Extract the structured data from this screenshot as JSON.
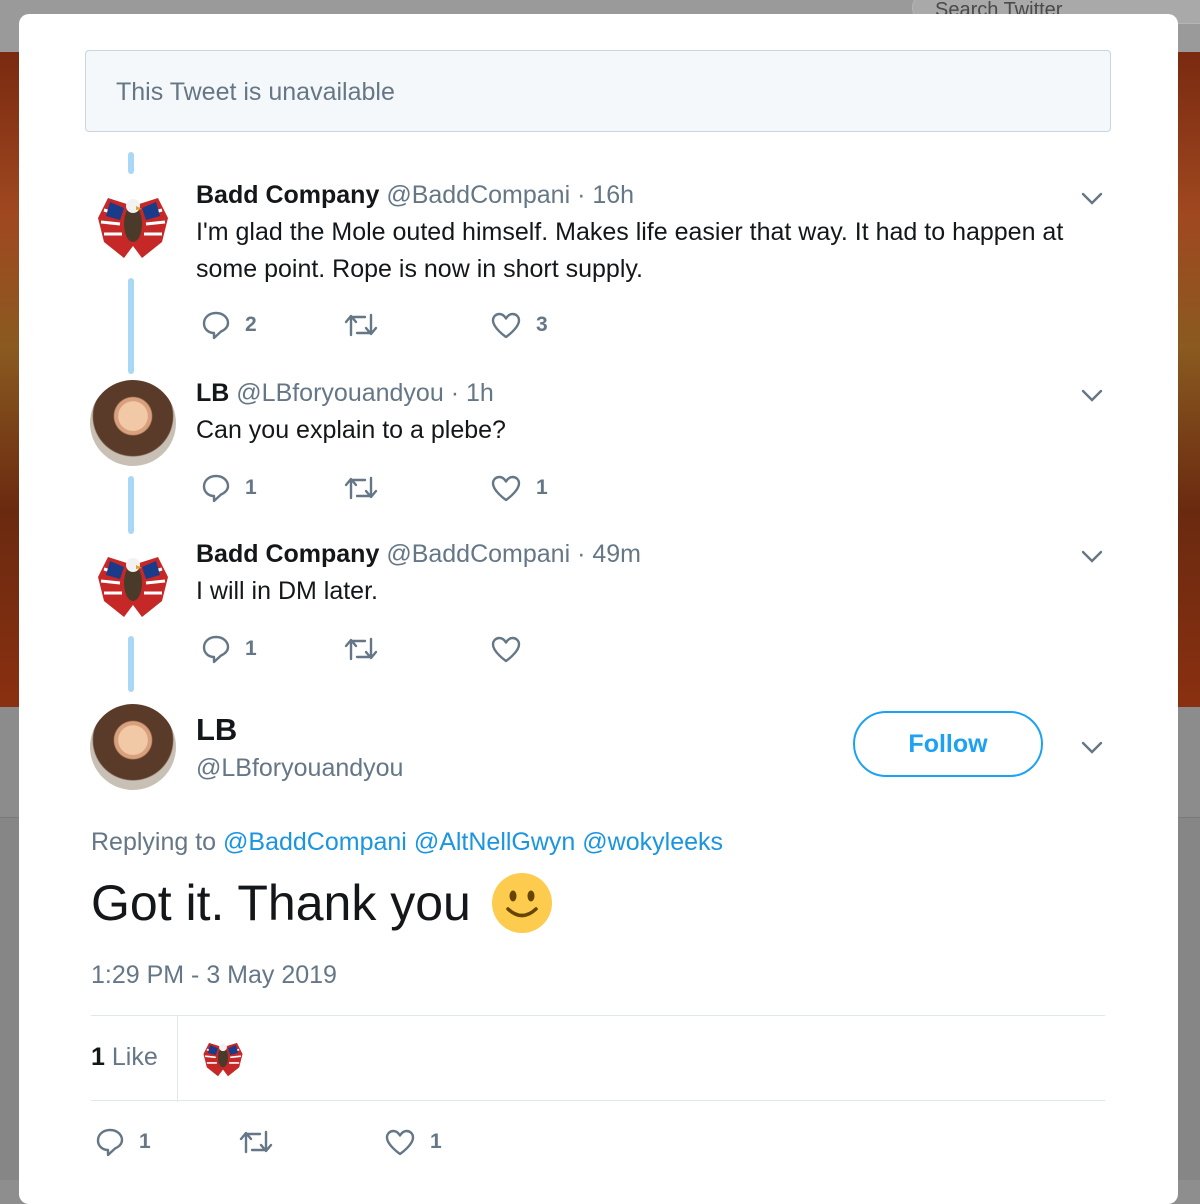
{
  "background": {
    "search_placeholder": "Search Twitter"
  },
  "unavailable_notice": "This Tweet is unavailable",
  "tweets": [
    {
      "name": "Badd Company",
      "handle": "@BaddCompani",
      "separator": "·",
      "time": "16h",
      "text": "I'm glad the Mole outed himself. Makes life easier that way. It had to happen at some point. Rope is now in short supply.",
      "replies": "2",
      "retweets": "",
      "likes": "3",
      "avatar": "eagle-flag-avatar"
    },
    {
      "name": "LB",
      "handle": "@LBforyouandyou",
      "separator": "·",
      "time": "1h",
      "text": "Can you explain to a plebe?",
      "replies": "1",
      "retweets": "",
      "likes": "1",
      "avatar": "woman-avatar"
    },
    {
      "name": "Badd Company",
      "handle": "@BaddCompani",
      "separator": "·",
      "time": "49m",
      "text": "I will in DM later.",
      "replies": "1",
      "retweets": "",
      "likes": "",
      "avatar": "eagle-flag-avatar"
    }
  ],
  "main_tweet": {
    "name": "LB",
    "handle": "@LBforyouandyou",
    "follow_label": "Follow",
    "replying_prefix": "Replying to",
    "mentions": [
      "@BaddCompani",
      "@AltNellGwyn",
      "@wokyleeks"
    ],
    "text": "Got it. Thank you",
    "emoji": "smiley-face",
    "timestamp": "1:29 PM - 3 May 2019",
    "like_count": "1",
    "like_label": "Like",
    "replies": "1",
    "retweets": "",
    "likes": "1"
  },
  "colors": {
    "accent": "#1da1f2",
    "thread_line": "#a9d7f6",
    "secondary_text": "#657786",
    "primary_text": "#14171a"
  }
}
